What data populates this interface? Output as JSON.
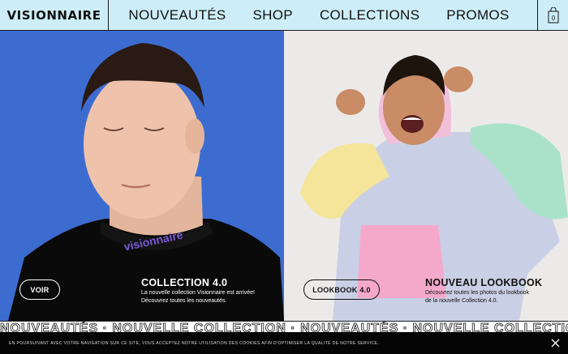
{
  "header": {
    "logo": "VISIONNAIRE",
    "nav": [
      "NOUVEAUTÉS",
      "SHOP",
      "COLLECTIONS",
      "PROMOS"
    ],
    "cart_count": "0"
  },
  "left_panel": {
    "button": "VOIR",
    "title": "COLLECTION 4.0",
    "desc1": "La nouvelle collection Visionnaire est arrivée!",
    "desc2": "Découvrez toutes les nouveautés.",
    "collar_text": "visionnaire"
  },
  "right_panel": {
    "button": "LOOKBOOK 4.0",
    "title": "NOUVEAU LOOKBOOK",
    "desc1": "Découvrez toutes les photos du lookbook",
    "desc2": "de la nouvelle Collection 4.0."
  },
  "marquee": "NOUVEAUTÉS · NOUVELLE COLLECTION · NOUVEAUTÉS · NOUVELLE COLLECTION ·",
  "cookie": {
    "text": "EN POURSUIVANT AVEC VOTRE NAVIGATION SUR CE SITE, VOUS ACCEPTEZ NOTRE UTILISATION DES COOKIES AFIN D'OPTIMISER LA QUALITÉ DE NOTRE SERVICE."
  },
  "colors": {
    "header_bg": "#cdeef8",
    "left_bg": "#3d6cd1",
    "right_bg": "#eceae9"
  }
}
